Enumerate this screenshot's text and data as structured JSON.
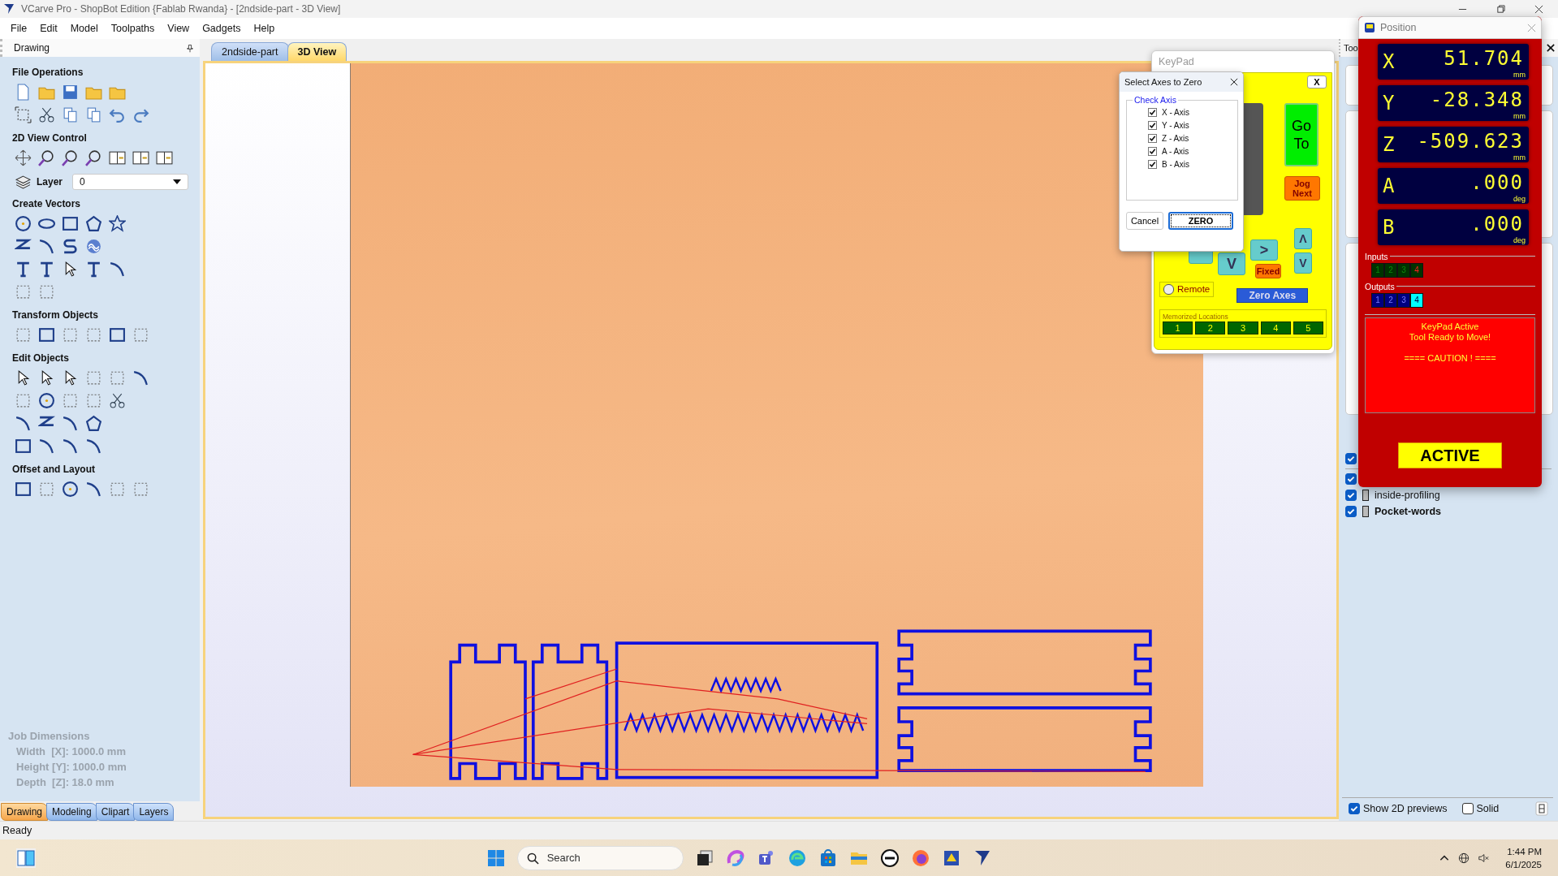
{
  "window": {
    "title": "VCarve Pro - ShopBot Edition {Fablab Rwanda} - [2ndside-part - 3D View]"
  },
  "menu": [
    "File",
    "Edit",
    "Model",
    "Toolpaths",
    "View",
    "Gadgets",
    "Help"
  ],
  "left_panel": {
    "title": "Drawing",
    "sections": [
      {
        "title": "File Operations"
      },
      {
        "title": "2D View Control"
      },
      {
        "title": "Create Vectors"
      },
      {
        "title": "Transform Objects"
      },
      {
        "title": "Edit Objects"
      },
      {
        "title": "Offset and Layout"
      }
    ],
    "layer": {
      "label": "Layer",
      "value": "0"
    },
    "job_dimensions": {
      "title": "Job Dimensions",
      "lines": [
        "Width  [X]: 1000.0 mm",
        "Height [Y]: 1000.0 mm",
        "Depth  [Z]: 18.0 mm"
      ]
    },
    "tabs": [
      {
        "label": "Drawing",
        "selected": true
      },
      {
        "label": "Modeling",
        "selected": false
      },
      {
        "label": "Clipart",
        "selected": false
      },
      {
        "label": "Layers",
        "selected": false
      }
    ]
  },
  "view_tabs": [
    {
      "label": "2ndside-part",
      "selected": false
    },
    {
      "label": "3D View",
      "selected": true
    }
  ],
  "keypad": {
    "title": "KeyPad",
    "close": "X",
    "goto": "Go To",
    "jog_next": "Jog Next",
    "arrows": [
      "V",
      ">",
      "Λ",
      "V"
    ],
    "fixed": "Fixed",
    "remote": {
      "label": "Remote",
      "checked": false
    },
    "zero_axes": "Zero Axes",
    "memorized": {
      "title": "Memorized Locations",
      "locations": [
        "1",
        "2",
        "3",
        "4",
        "5"
      ]
    }
  },
  "select_axes_dialog": {
    "title": "Select Axes to Zero",
    "group": "Check Axis",
    "axes": [
      {
        "label": "X - Axis",
        "checked": true
      },
      {
        "label": "Y - Axis",
        "checked": true
      },
      {
        "label": "Z - Axis",
        "checked": true
      },
      {
        "label": "A - Axis",
        "checked": true
      },
      {
        "label": "B - Axis",
        "checked": true
      }
    ],
    "buttons": [
      "Cancel",
      "ZERO"
    ]
  },
  "position": {
    "title": "Position",
    "axes": [
      {
        "letter": "X",
        "value": "51.704",
        "unit": "mm"
      },
      {
        "letter": "Y",
        "value": "-28.348",
        "unit": "mm"
      },
      {
        "letter": "Z",
        "value": "-509.623",
        "unit": "mm"
      },
      {
        "letter": "A",
        "value": ".000",
        "unit": "deg"
      },
      {
        "letter": "B",
        "value": ".000",
        "unit": "deg"
      }
    ],
    "inputs": {
      "label": "Inputs",
      "items": [
        {
          "label": "1",
          "on": false
        },
        {
          "label": "2",
          "on": false
        },
        {
          "label": "3",
          "on": false
        },
        {
          "label": "4",
          "on": true
        }
      ]
    },
    "outputs": {
      "label": "Outputs",
      "items": [
        {
          "label": "1",
          "on": false
        },
        {
          "label": "2",
          "on": false
        },
        {
          "label": "3",
          "on": false
        },
        {
          "label": "4",
          "on": true
        }
      ]
    },
    "message": [
      "KeyPad Active",
      "Tool Ready to Move!"
    ],
    "caution": "==== CAUTION ! ====",
    "status": "ACTIVE"
  },
  "right_panel": {
    "title": "Too",
    "toolpaths": [
      {
        "checked": true
      },
      {
        "checked": true
      },
      {
        "name": "inside-profiling",
        "checked": true,
        "bold": false
      },
      {
        "name": "Pocket-words",
        "checked": true,
        "bold": true
      }
    ],
    "show_2d_previews": {
      "label": "Show 2D previews",
      "checked": true
    },
    "solid": {
      "label": "Solid",
      "checked": false
    }
  },
  "status_bar": "Ready",
  "taskbar": {
    "search_placeholder": "Search",
    "time": "1:44 PM",
    "date": "6/1/2025"
  }
}
